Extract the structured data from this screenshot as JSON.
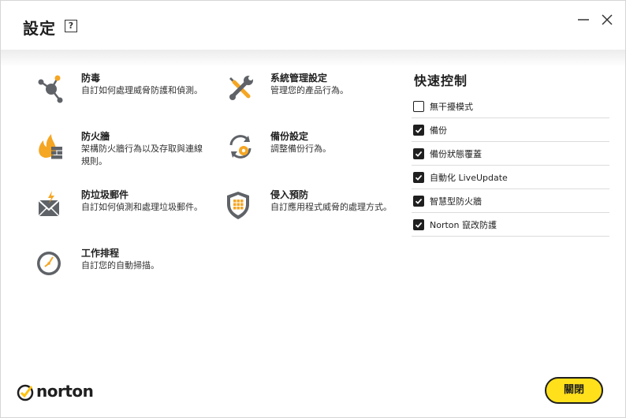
{
  "header": {
    "title": "設定",
    "help": "?"
  },
  "settings": {
    "antivirus": {
      "name": "防毒",
      "desc": "自訂如何處理威脅防護和偵測。",
      "icon": "antivirus-icon"
    },
    "admin": {
      "name": "系統管理設定",
      "desc": "管理您的產品行為。",
      "icon": "admin-tools-icon"
    },
    "firewall": {
      "name": "防火牆",
      "desc": "架構防火牆行為以及存取與連線規則。",
      "icon": "firewall-icon"
    },
    "backup": {
      "name": "備份設定",
      "desc": "調整備份行為。",
      "icon": "backup-settings-icon"
    },
    "antispam": {
      "name": "防垃圾郵件",
      "desc": "自訂如何偵測和處理垃圾郵件。",
      "icon": "antispam-icon"
    },
    "intrusion": {
      "name": "侵入預防",
      "desc": "自訂應用程式威脅的處理方式。",
      "icon": "intrusion-shield-icon"
    },
    "scheduling": {
      "name": "工作排程",
      "desc": "自訂您的自動掃描。",
      "icon": "clock-icon"
    }
  },
  "quick_controls": {
    "title": "快速控制",
    "items": [
      {
        "label": "無干擾模式",
        "checked": false
      },
      {
        "label": "備份",
        "checked": true
      },
      {
        "label": "備份狀態覆蓋",
        "checked": true
      },
      {
        "label": "自動化 LiveUpdate",
        "checked": true
      },
      {
        "label": "智慧型防火牆",
        "checked": true
      },
      {
        "label": "Norton 竄改防護",
        "checked": true
      }
    ]
  },
  "footer": {
    "brand": "norton",
    "close_label": "關閉"
  },
  "colors": {
    "accent_yellow": "#ffe01b",
    "icon_orange": "#f5a623",
    "icon_gray": "#5f6368"
  }
}
